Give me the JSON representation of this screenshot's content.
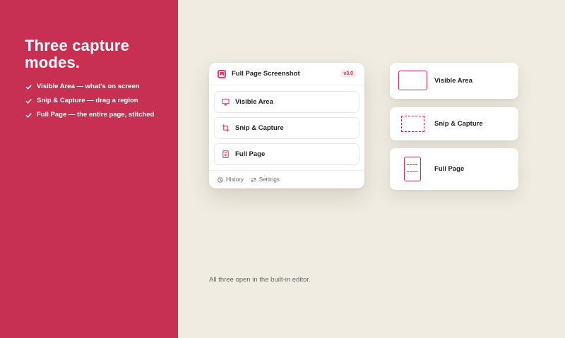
{
  "left_panel": {
    "headline": "Three capture modes.",
    "features": [
      "Visible Area — what's on screen",
      "Snip & Capture — drag a region",
      "Full Page — the entire page, stitched"
    ]
  },
  "popup": {
    "title": "Full Page Screenshot",
    "version": "v3.0",
    "options": [
      {
        "label": "Visible Area",
        "icon": "monitor-icon"
      },
      {
        "label": "Snip & Capture",
        "icon": "crop-icon"
      },
      {
        "label": "Full Page",
        "icon": "document-icon"
      }
    ],
    "footer": {
      "history_label": "History",
      "settings_label": "Settings"
    }
  },
  "mode_cards": [
    {
      "label": "Visible Area"
    },
    {
      "label": "Snip & Capture"
    },
    {
      "label": "Full Page"
    }
  ],
  "caption": "All three open in the built-in editor.",
  "colors": {
    "accent": "#c73053",
    "background": "#f0ece2",
    "card": "#ffffff"
  }
}
